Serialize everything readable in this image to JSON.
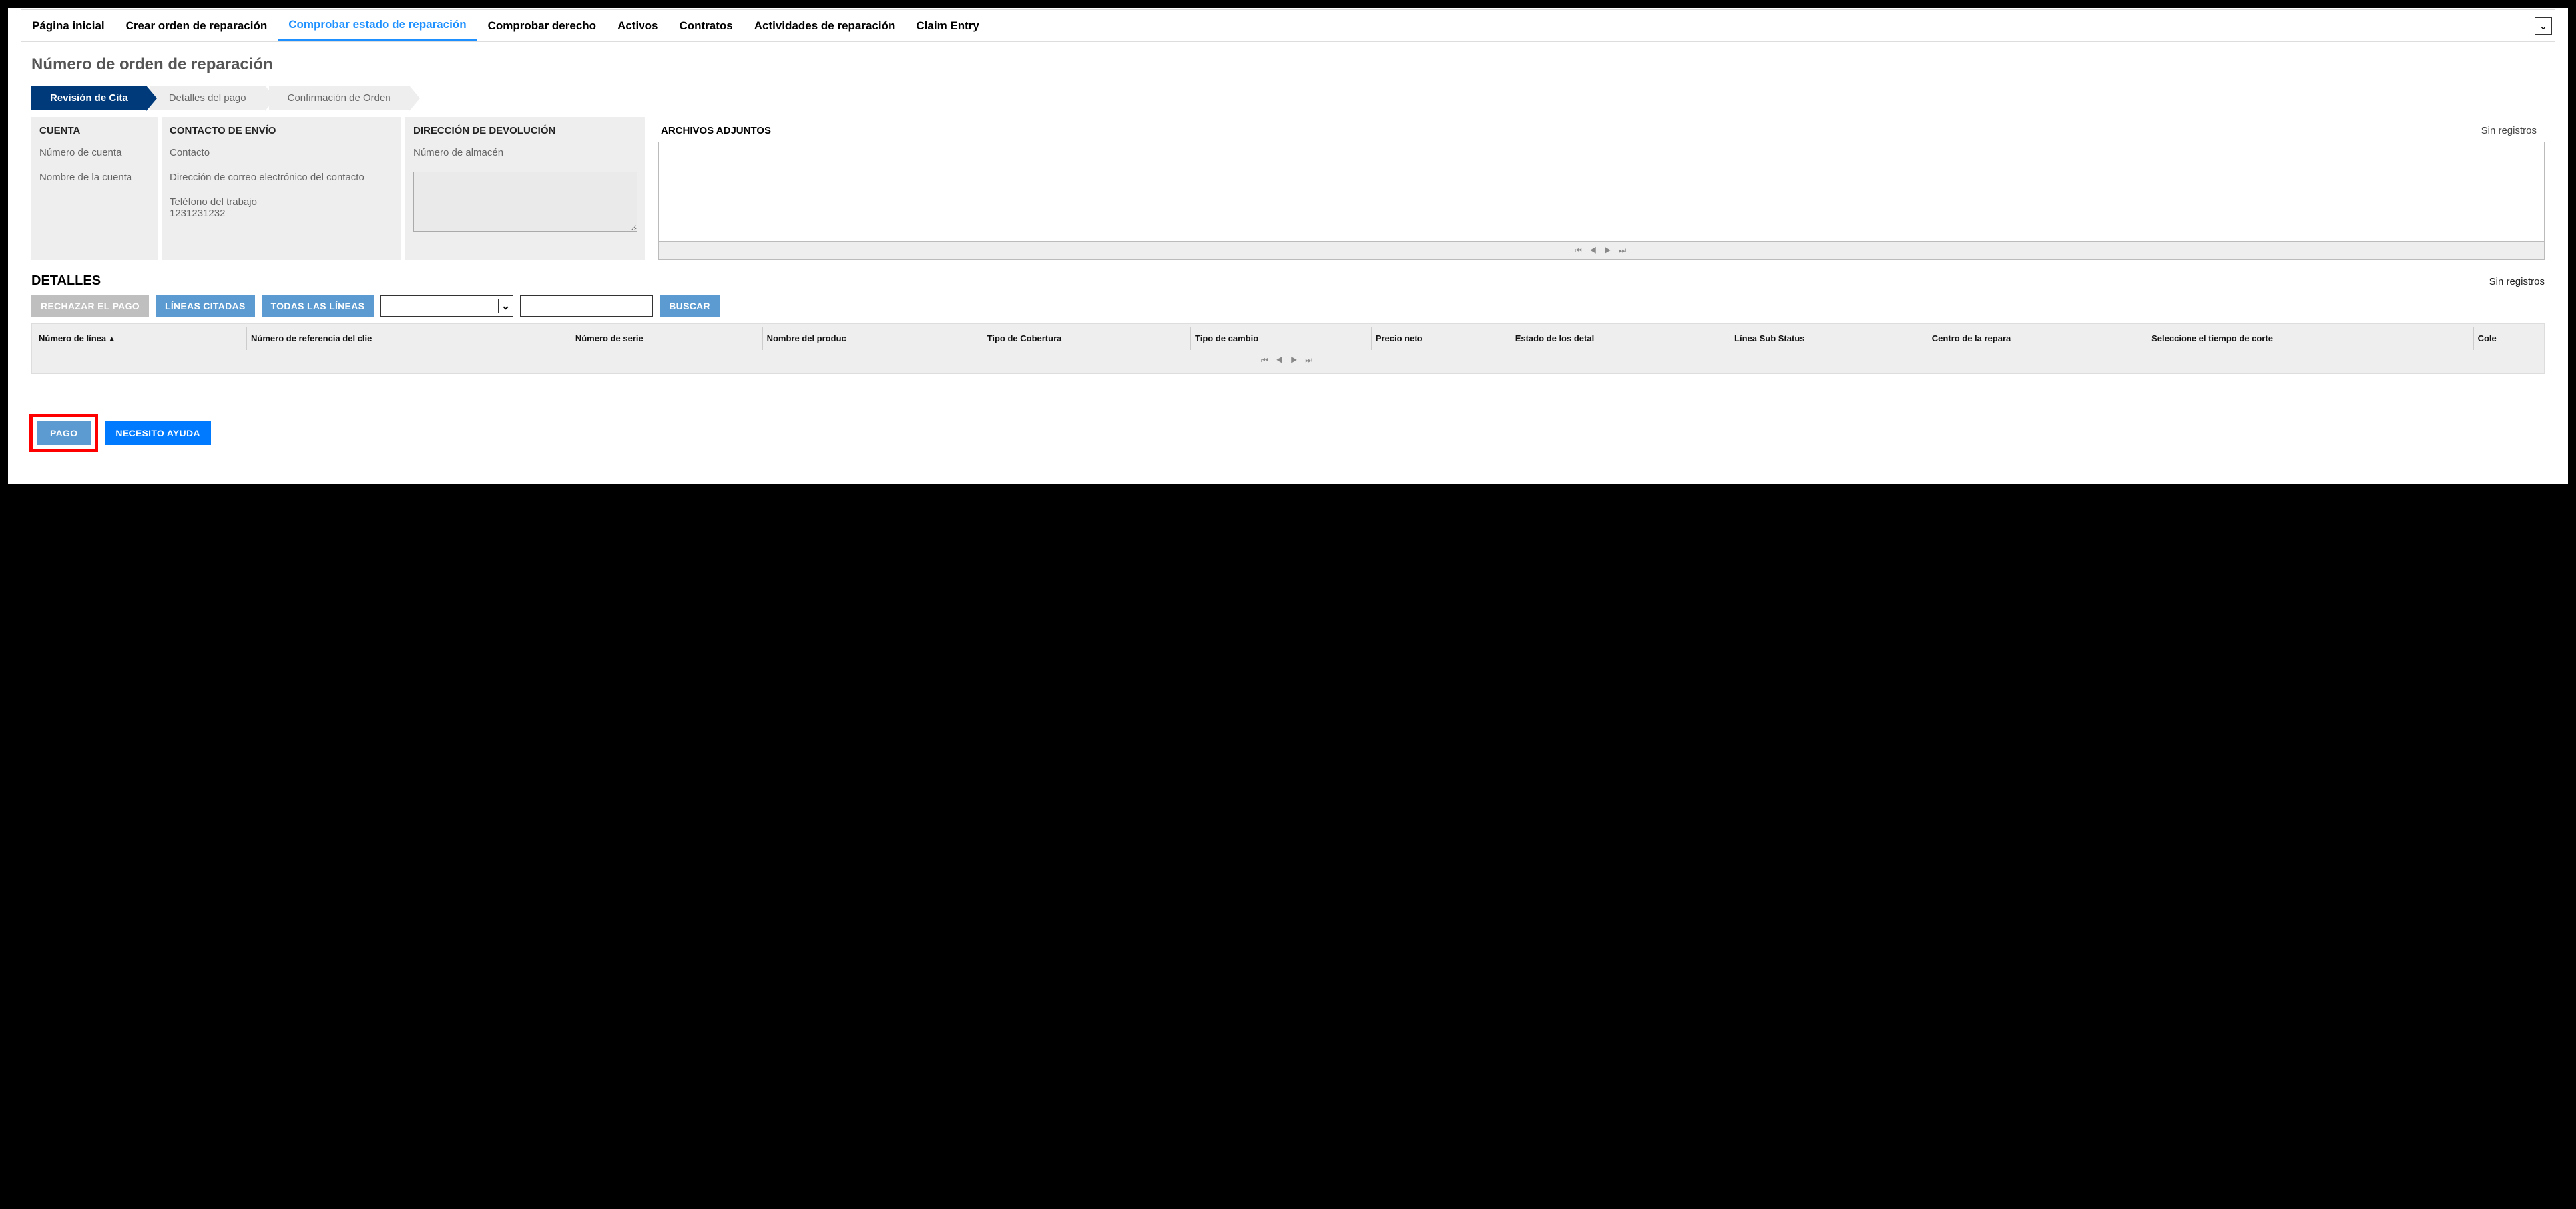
{
  "nav": {
    "items": [
      {
        "label": "Página inicial"
      },
      {
        "label": "Crear orden de reparación"
      },
      {
        "label": "Comprobar estado de reparación",
        "active": true
      },
      {
        "label": "Comprobar derecho"
      },
      {
        "label": "Activos"
      },
      {
        "label": "Contratos"
      },
      {
        "label": "Actividades de reparación"
      },
      {
        "label": "Claim Entry"
      }
    ]
  },
  "page": {
    "title": "Número de orden de reparación"
  },
  "steps": {
    "s1": "Revisión de Cita",
    "s2": "Detalles del pago",
    "s3": "Confirmación de Orden"
  },
  "cuenta": {
    "header": "CUENTA",
    "num_label": "Número de cuenta",
    "name_label": "Nombre de la cuenta"
  },
  "contacto": {
    "header": "CONTACTO DE ENVÍO",
    "contact_label": "Contacto",
    "email_label": "Dirección de correo electrónico del contacto",
    "phone_label": "Teléfono del trabajo",
    "phone_value": "1231231232"
  },
  "direccion": {
    "header": "DIRECCIÓN DE DEVOLUCIÓN",
    "almacen_label": "Número de almacén",
    "textarea_value": ""
  },
  "archivos": {
    "header": "ARCHIVOS ADJUNTOS",
    "hint": "Sin registros"
  },
  "detalles": {
    "title": "DETALLES",
    "hint": "Sin registros"
  },
  "filters": {
    "rechazar": "RECHAZAR EL PAGO",
    "lineas_citadas": "LÍNEAS CITADAS",
    "todas": "TODAS LAS LÍNEAS",
    "select_value": "",
    "input_value": "",
    "buscar": "BUSCAR"
  },
  "table": {
    "columns": [
      "Número de línea",
      "Número de referencia del clie",
      "Número de serie",
      "Nombre del produc",
      "Tipo de Cobertura",
      "Tipo de cambio",
      "Precio neto",
      "Estado de los detal",
      "Línea Sub Status",
      "Centro de la repara",
      "Seleccione el tiempo de corte",
      "Cole"
    ]
  },
  "bottom": {
    "pago": "PAGO",
    "ayuda": "NECESITO AYUDA"
  },
  "glyphs": {
    "pager": "⏮ ◀ ▶ ⏭",
    "chevron_down": "⌄",
    "sort_asc": "▲"
  }
}
